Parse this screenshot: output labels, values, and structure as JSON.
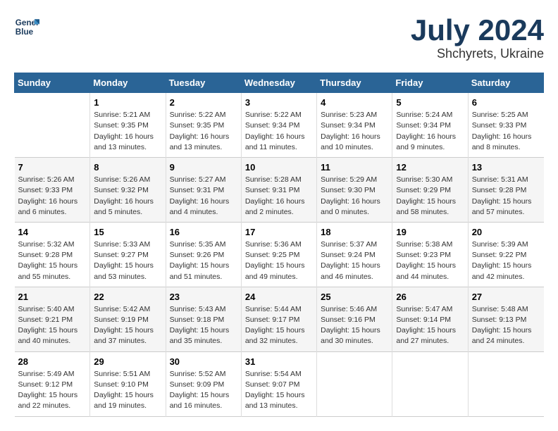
{
  "logo": {
    "line1": "General",
    "line2": "Blue"
  },
  "title": {
    "month_year": "July 2024",
    "location": "Shchyrets, Ukraine"
  },
  "headers": [
    "Sunday",
    "Monday",
    "Tuesday",
    "Wednesday",
    "Thursday",
    "Friday",
    "Saturday"
  ],
  "weeks": [
    [
      {
        "day": "",
        "info": ""
      },
      {
        "day": "1",
        "info": "Sunrise: 5:21 AM\nSunset: 9:35 PM\nDaylight: 16 hours\nand 13 minutes."
      },
      {
        "day": "2",
        "info": "Sunrise: 5:22 AM\nSunset: 9:35 PM\nDaylight: 16 hours\nand 13 minutes."
      },
      {
        "day": "3",
        "info": "Sunrise: 5:22 AM\nSunset: 9:34 PM\nDaylight: 16 hours\nand 11 minutes."
      },
      {
        "day": "4",
        "info": "Sunrise: 5:23 AM\nSunset: 9:34 PM\nDaylight: 16 hours\nand 10 minutes."
      },
      {
        "day": "5",
        "info": "Sunrise: 5:24 AM\nSunset: 9:34 PM\nDaylight: 16 hours\nand 9 minutes."
      },
      {
        "day": "6",
        "info": "Sunrise: 5:25 AM\nSunset: 9:33 PM\nDaylight: 16 hours\nand 8 minutes."
      }
    ],
    [
      {
        "day": "7",
        "info": "Sunrise: 5:26 AM\nSunset: 9:33 PM\nDaylight: 16 hours\nand 6 minutes."
      },
      {
        "day": "8",
        "info": "Sunrise: 5:26 AM\nSunset: 9:32 PM\nDaylight: 16 hours\nand 5 minutes."
      },
      {
        "day": "9",
        "info": "Sunrise: 5:27 AM\nSunset: 9:31 PM\nDaylight: 16 hours\nand 4 minutes."
      },
      {
        "day": "10",
        "info": "Sunrise: 5:28 AM\nSunset: 9:31 PM\nDaylight: 16 hours\nand 2 minutes."
      },
      {
        "day": "11",
        "info": "Sunrise: 5:29 AM\nSunset: 9:30 PM\nDaylight: 16 hours\nand 0 minutes."
      },
      {
        "day": "12",
        "info": "Sunrise: 5:30 AM\nSunset: 9:29 PM\nDaylight: 15 hours\nand 58 minutes."
      },
      {
        "day": "13",
        "info": "Sunrise: 5:31 AM\nSunset: 9:28 PM\nDaylight: 15 hours\nand 57 minutes."
      }
    ],
    [
      {
        "day": "14",
        "info": "Sunrise: 5:32 AM\nSunset: 9:28 PM\nDaylight: 15 hours\nand 55 minutes."
      },
      {
        "day": "15",
        "info": "Sunrise: 5:33 AM\nSunset: 9:27 PM\nDaylight: 15 hours\nand 53 minutes."
      },
      {
        "day": "16",
        "info": "Sunrise: 5:35 AM\nSunset: 9:26 PM\nDaylight: 15 hours\nand 51 minutes."
      },
      {
        "day": "17",
        "info": "Sunrise: 5:36 AM\nSunset: 9:25 PM\nDaylight: 15 hours\nand 49 minutes."
      },
      {
        "day": "18",
        "info": "Sunrise: 5:37 AM\nSunset: 9:24 PM\nDaylight: 15 hours\nand 46 minutes."
      },
      {
        "day": "19",
        "info": "Sunrise: 5:38 AM\nSunset: 9:23 PM\nDaylight: 15 hours\nand 44 minutes."
      },
      {
        "day": "20",
        "info": "Sunrise: 5:39 AM\nSunset: 9:22 PM\nDaylight: 15 hours\nand 42 minutes."
      }
    ],
    [
      {
        "day": "21",
        "info": "Sunrise: 5:40 AM\nSunset: 9:21 PM\nDaylight: 15 hours\nand 40 minutes."
      },
      {
        "day": "22",
        "info": "Sunrise: 5:42 AM\nSunset: 9:19 PM\nDaylight: 15 hours\nand 37 minutes."
      },
      {
        "day": "23",
        "info": "Sunrise: 5:43 AM\nSunset: 9:18 PM\nDaylight: 15 hours\nand 35 minutes."
      },
      {
        "day": "24",
        "info": "Sunrise: 5:44 AM\nSunset: 9:17 PM\nDaylight: 15 hours\nand 32 minutes."
      },
      {
        "day": "25",
        "info": "Sunrise: 5:46 AM\nSunset: 9:16 PM\nDaylight: 15 hours\nand 30 minutes."
      },
      {
        "day": "26",
        "info": "Sunrise: 5:47 AM\nSunset: 9:14 PM\nDaylight: 15 hours\nand 27 minutes."
      },
      {
        "day": "27",
        "info": "Sunrise: 5:48 AM\nSunset: 9:13 PM\nDaylight: 15 hours\nand 24 minutes."
      }
    ],
    [
      {
        "day": "28",
        "info": "Sunrise: 5:49 AM\nSunset: 9:12 PM\nDaylight: 15 hours\nand 22 minutes."
      },
      {
        "day": "29",
        "info": "Sunrise: 5:51 AM\nSunset: 9:10 PM\nDaylight: 15 hours\nand 19 minutes."
      },
      {
        "day": "30",
        "info": "Sunrise: 5:52 AM\nSunset: 9:09 PM\nDaylight: 15 hours\nand 16 minutes."
      },
      {
        "day": "31",
        "info": "Sunrise: 5:54 AM\nSunset: 9:07 PM\nDaylight: 15 hours\nand 13 minutes."
      },
      {
        "day": "",
        "info": ""
      },
      {
        "day": "",
        "info": ""
      },
      {
        "day": "",
        "info": ""
      }
    ]
  ]
}
